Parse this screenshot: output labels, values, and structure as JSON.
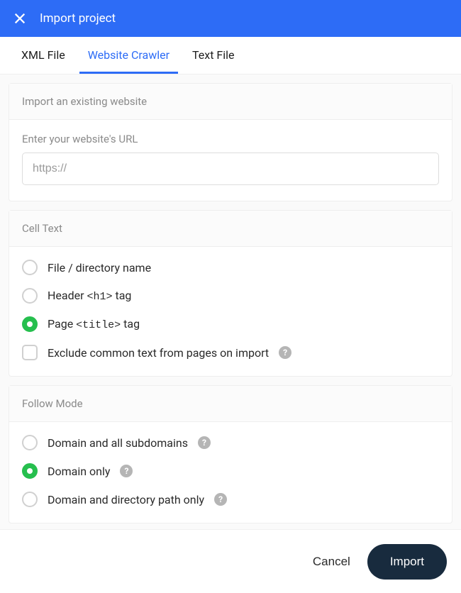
{
  "header": {
    "title": "Import project"
  },
  "tabs": [
    {
      "label": "XML File",
      "active": false
    },
    {
      "label": "Website Crawler",
      "active": true
    },
    {
      "label": "Text File",
      "active": false
    }
  ],
  "sections": {
    "website": {
      "title": "Import an existing website",
      "url_field_label": "Enter your website's URL",
      "url_placeholder": "https://"
    },
    "cell_text": {
      "title": "Cell Text",
      "options": [
        {
          "label": "File / directory name",
          "selected": false
        },
        {
          "label_pre": "Header ",
          "label_code": "<h1>",
          "label_post": " tag",
          "selected": false
        },
        {
          "label_pre": "Page ",
          "label_code": "<title>",
          "label_post": " tag",
          "selected": true
        }
      ],
      "exclude_label": "Exclude common text from pages on import"
    },
    "follow_mode": {
      "title": "Follow Mode",
      "options": [
        {
          "label": "Domain and all subdomains",
          "selected": false,
          "help": true
        },
        {
          "label": "Domain only",
          "selected": true,
          "help": true
        },
        {
          "label": "Domain and directory path only",
          "selected": false,
          "help": true
        }
      ]
    }
  },
  "footer": {
    "cancel": "Cancel",
    "import": "Import"
  },
  "help_glyph": "?"
}
